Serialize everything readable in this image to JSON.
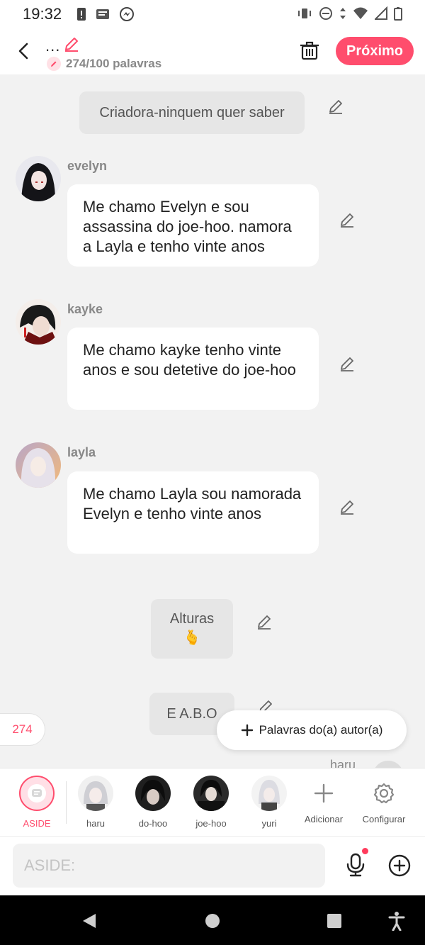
{
  "status_bar": {
    "time": "19:32"
  },
  "header": {
    "title": "...",
    "word_count": "274/100 palavras",
    "next_label": "Próximo"
  },
  "messages": {
    "narration_1": "Criadora-ninquem quer saber",
    "evelyn": {
      "name": "evelyn",
      "text": "Me chamo Evelyn e sou assassina do joe-hoo. namora a Layla e tenho vinte anos"
    },
    "kayke": {
      "name": "kayke",
      "text": "Me chamo kayke tenho vinte anos e sou detetive do joe-hoo"
    },
    "layla": {
      "name": "layla",
      "text": "Me chamo Layla sou namorada Evelyn e tenho vinte anos"
    },
    "narration_2": "Alturas",
    "narration_2_emoji": "🫰",
    "narration_3": "E A.B.O",
    "partial_name": "haru"
  },
  "word_count_badge": "274",
  "author_words_button": "Palavras do(a) autor(a)",
  "characters": [
    {
      "label": "ASIDE"
    },
    {
      "label": "haru"
    },
    {
      "label": "do-hoo"
    },
    {
      "label": "joe-hoo"
    },
    {
      "label": "yuri"
    },
    {
      "label": "Adicionar"
    },
    {
      "label": "Configurar"
    }
  ],
  "input": {
    "placeholder": "ASIDE:"
  },
  "colors": {
    "accent": "#ff4d6d",
    "bubble_bg": "#ffffff",
    "chat_bg": "#f2f2f2"
  }
}
